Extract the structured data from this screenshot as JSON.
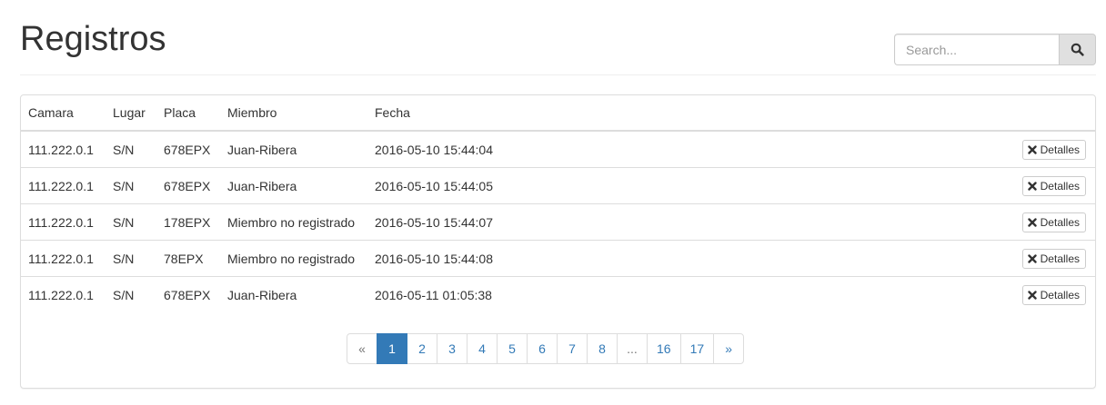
{
  "header": {
    "title": "Registros"
  },
  "search": {
    "placeholder": "Search...",
    "value": ""
  },
  "table": {
    "columns": [
      "Camara",
      "Lugar",
      "Placa",
      "Miembro",
      "Fecha"
    ],
    "rows": [
      {
        "camara": "111.222.0.1",
        "lugar": "S/N",
        "placa": "678EPX",
        "miembro": "Juan-Ribera",
        "fecha": "2016-05-10 15:44:04",
        "action": "Detalles"
      },
      {
        "camara": "111.222.0.1",
        "lugar": "S/N",
        "placa": "678EPX",
        "miembro": "Juan-Ribera",
        "fecha": "2016-05-10 15:44:05",
        "action": "Detalles"
      },
      {
        "camara": "111.222.0.1",
        "lugar": "S/N",
        "placa": "178EPX",
        "miembro": "Miembro no registrado",
        "fecha": "2016-05-10 15:44:07",
        "action": "Detalles"
      },
      {
        "camara": "111.222.0.1",
        "lugar": "S/N",
        "placa": "78EPX",
        "miembro": "Miembro no registrado",
        "fecha": "2016-05-10 15:44:08",
        "action": "Detalles"
      },
      {
        "camara": "111.222.0.1",
        "lugar": "S/N",
        "placa": "678EPX",
        "miembro": "Juan-Ribera",
        "fecha": "2016-05-11 01:05:38",
        "action": "Detalles"
      }
    ]
  },
  "pagination": {
    "prev": "«",
    "pages": [
      "1",
      "2",
      "3",
      "4",
      "5",
      "6",
      "7",
      "8",
      "...",
      "16",
      "17"
    ],
    "next": "»",
    "current": "1"
  },
  "icons": {
    "search": "search-icon",
    "details": "close-icon"
  },
  "colors": {
    "accent": "#337ab7",
    "border": "#dddddd",
    "search_button_bg": "#e0e0e0"
  }
}
